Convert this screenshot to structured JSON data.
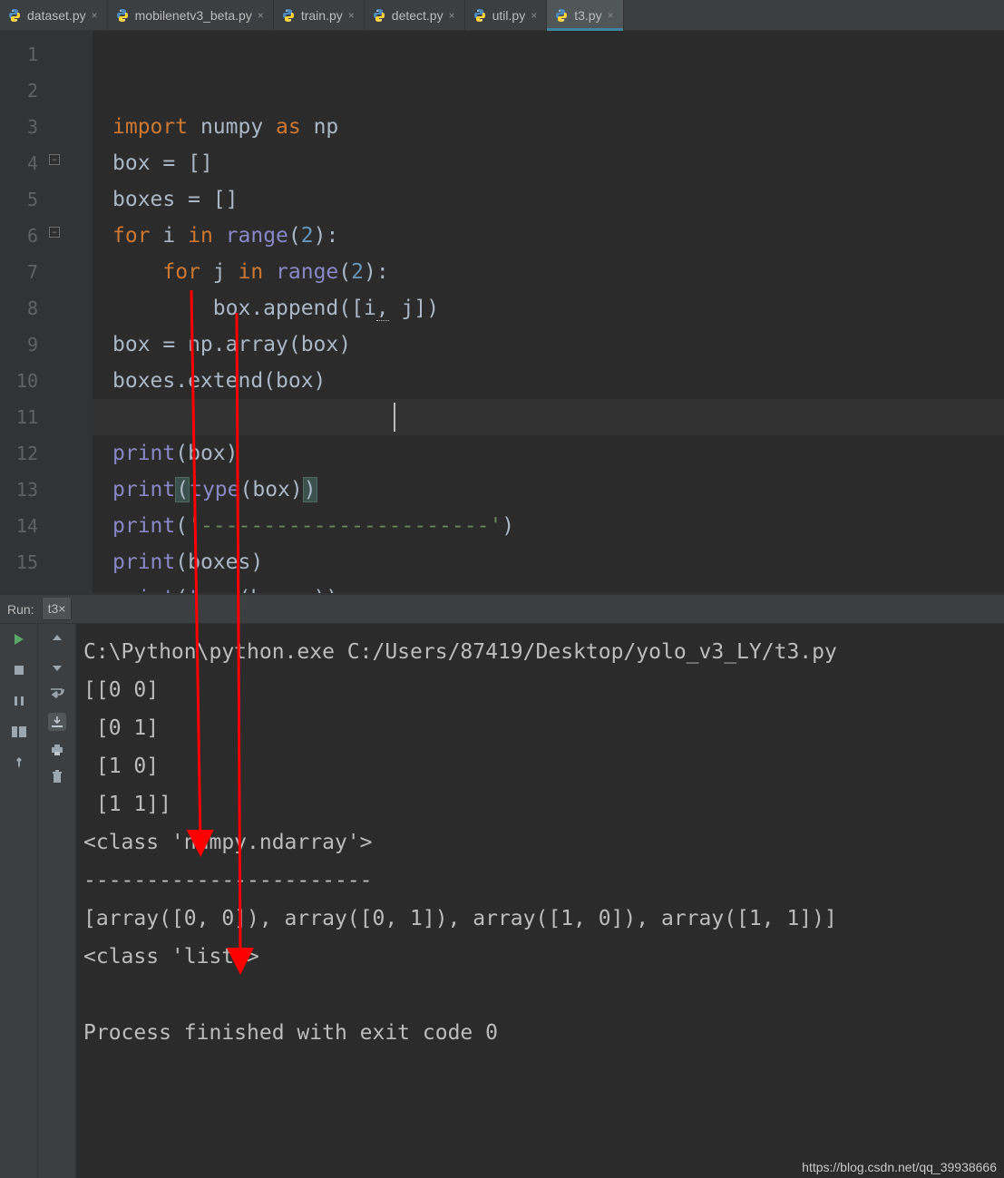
{
  "tabs": [
    {
      "label": "dataset.py",
      "active": false
    },
    {
      "label": "mobilenetv3_beta.py",
      "active": false
    },
    {
      "label": "train.py",
      "active": false
    },
    {
      "label": "detect.py",
      "active": false
    },
    {
      "label": "util.py",
      "active": false
    },
    {
      "label": "t3.py",
      "active": true
    }
  ],
  "gutter_lines": [
    "1",
    "2",
    "3",
    "4",
    "5",
    "6",
    "7",
    "8",
    "9",
    "10",
    "11",
    "12",
    "13",
    "14",
    "15"
  ],
  "code": {
    "l1": {
      "a": "import",
      "b": " numpy ",
      "c": "as",
      "d": " np"
    },
    "l2": "box = []",
    "l3": "boxes = []",
    "l4": {
      "a": "for",
      "b": " i ",
      "c": "in",
      "d": " ",
      "e": "range",
      "f": "(",
      "g": "2",
      "h": "):"
    },
    "l5": {
      "a": "for",
      "b": " j ",
      "c": "in",
      "d": " ",
      "e": "range",
      "f": "(",
      "g": "2",
      "h": "):"
    },
    "l6": {
      "a": "box.append([i",
      "b": ",",
      "c": "j])"
    },
    "l7": "box = np.array(box)",
    "l8": "boxes.extend(box)",
    "l10": {
      "a": "print",
      "b": "(box)"
    },
    "l11": {
      "a": "print",
      "b": "(",
      "c": "type",
      "d": "(box)",
      "e": ")"
    },
    "l12": {
      "a": "print",
      "b": "(",
      "c": "'-----------------------'",
      "d": ")"
    },
    "l13": {
      "a": "print",
      "b": "(boxes)"
    },
    "l14": {
      "a": "print",
      "b": "(",
      "c": "type",
      "d": "(boxes))"
    }
  },
  "run": {
    "label": "Run:",
    "config": "t3",
    "close": "×"
  },
  "console_lines": [
    "C:\\Python\\python.exe C:/Users/87419/Desktop/yolo_v3_LY/t3.py",
    "[[0 0]",
    " [0 1]",
    " [1 0]",
    " [1 1]]",
    "<class 'numpy.ndarray'>",
    "-----------------------",
    "[array([0, 0]), array([0, 1]), array([1, 0]), array([1, 1])]",
    "<class 'list'>",
    "",
    "Process finished with exit code 0"
  ],
  "watermark": "https://blog.csdn.net/qq_39938666",
  "icons": {
    "close_glyph": "×"
  }
}
